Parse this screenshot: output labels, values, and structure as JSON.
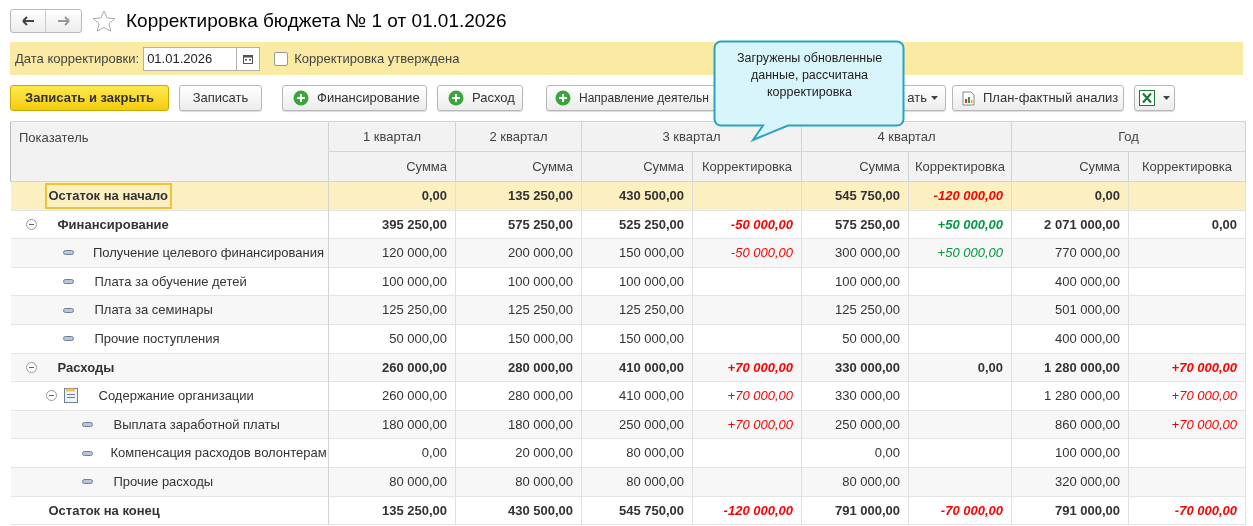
{
  "window": {
    "title": "Корректировка бюджета № 1 от 01.01.2026",
    "favorite": false
  },
  "filter": {
    "date_label": "Дата корректировки:",
    "date_value": "01.01.2026",
    "approved_label": "Корректировка утверждена",
    "approved": false
  },
  "toolbar": [
    {
      "kind": "primary",
      "label": "Записать и закрыть"
    },
    {
      "kind": "plain",
      "label": "Записать"
    },
    {
      "kind": "add",
      "label": "Финансирование"
    },
    {
      "kind": "add",
      "label": "Расход"
    },
    {
      "kind": "add_cut",
      "label": "Направление деятельн"
    },
    {
      "kind": "menu_cut",
      "label": "ать"
    },
    {
      "kind": "report",
      "label": "План-фактный анализ"
    },
    {
      "kind": "excel"
    }
  ],
  "tooltip": "Загружены обновленные данные, рассчитана корректировка",
  "table": {
    "first_column": "Показатель",
    "columns": [
      {
        "label": "1 квартал",
        "sub": [
          "Сумма"
        ]
      },
      {
        "label": "2 квартал",
        "sub": [
          "Сумма"
        ]
      },
      {
        "label": "3 квартал",
        "colspan": 2,
        "sub": [
          "Сумма",
          "Корректировка"
        ]
      },
      {
        "label": "4 квартал",
        "colspan": 2,
        "sub": [
          "Сумма",
          "Корректировка"
        ]
      },
      {
        "label": "Год",
        "colspan": 2,
        "sub": [
          "Сумма",
          "Корректировка"
        ]
      }
    ],
    "rows": [
      {
        "kind": "balance",
        "label": "Остаток на начало",
        "selected": true,
        "cells": [
          {
            "text": "0,00"
          },
          {
            "text": "135 250,00"
          },
          {
            "text": "430 500,00"
          },
          null,
          {
            "text": "545 750,00"
          },
          {
            "text": "-120 000,00",
            "color": "#ff0000"
          },
          {
            "text": "0,00"
          },
          null
        ]
      },
      {
        "kind": "group",
        "label": "Финансирование",
        "selected": false,
        "expanded": true,
        "cells": [
          {
            "text": "395 250,00"
          },
          {
            "text": "575 250,00"
          },
          {
            "text": "525 250,00"
          },
          {
            "text": "-50 000,00",
            "color": "#ff0000"
          },
          {
            "text": "575 250,00"
          },
          {
            "text": "+50 000,00",
            "color": "#009944"
          },
          {
            "text": "2 071 000,00"
          },
          {
            "text": "0,00"
          }
        ],
        "children": [
          {
            "kind": "item",
            "label": "Получение целевого финансирования",
            "selected": false,
            "cells": [
              {
                "text": "120 000,00"
              },
              {
                "text": "200 000,00"
              },
              {
                "text": "150 000,00"
              },
              {
                "text": "-50 000,00",
                "color": "#ff0000"
              },
              {
                "text": "300 000,00"
              },
              {
                "text": "+50 000,00",
                "color": "#009944"
              },
              {
                "text": "770 000,00"
              },
              null
            ]
          },
          {
            "kind": "item",
            "label": "Плата за обучение детей",
            "selected": false,
            "cells": [
              {
                "text": "100 000,00"
              },
              {
                "text": "100 000,00"
              },
              {
                "text": "100 000,00"
              },
              null,
              {
                "text": "100 000,00"
              },
              null,
              {
                "text": "400 000,00"
              },
              null
            ]
          },
          {
            "kind": "item",
            "label": "Плата за семинары",
            "selected": false,
            "cells": [
              {
                "text": "125 250,00"
              },
              {
                "text": "125 250,00"
              },
              {
                "text": "125 250,00"
              },
              null,
              {
                "text": "125 250,00"
              },
              null,
              {
                "text": "501 000,00"
              },
              null
            ]
          },
          {
            "kind": "item",
            "label": "Прочие поступления",
            "selected": false,
            "cells": [
              {
                "text": "50 000,00"
              },
              {
                "text": "150 000,00"
              },
              {
                "text": "150 000,00"
              },
              null,
              {
                "text": "50 000,00"
              },
              null,
              {
                "text": "400 000,00"
              },
              null
            ]
          }
        ]
      },
      {
        "kind": "group",
        "label": "Расходы",
        "selected": false,
        "expanded": true,
        "cells": [
          {
            "text": "260 000,00"
          },
          {
            "text": "280 000,00"
          },
          {
            "text": "410 000,00"
          },
          {
            "text": "+70 000,00",
            "color": "#ff0000"
          },
          {
            "text": "330 000,00"
          },
          {
            "text": "0,00"
          },
          {
            "text": "1 280 000,00"
          },
          {
            "text": "+70 000,00",
            "color": "#ff0000"
          }
        ],
        "children": [
          {
            "kind": "folder",
            "label": "Содержание организации",
            "selected": false,
            "expanded": true,
            "cells": [
              {
                "text": "260 000,00"
              },
              {
                "text": "280 000,00"
              },
              {
                "text": "410 000,00"
              },
              {
                "text": "+70 000,00",
                "color": "#ff0000"
              },
              {
                "text": "330 000,00"
              },
              null,
              {
                "text": "1 280 000,00"
              },
              {
                "text": "+70 000,00",
                "color": "#ff0000"
              }
            ],
            "children": [
              {
                "kind": "item",
                "label": "Выплата заработной платы",
                "selected": false,
                "cells": [
                  {
                    "text": "180 000,00"
                  },
                  {
                    "text": "180 000,00"
                  },
                  {
                    "text": "250 000,00"
                  },
                  {
                    "text": "+70 000,00",
                    "color": "#ff0000"
                  },
                  {
                    "text": "250 000,00"
                  },
                  null,
                  {
                    "text": "860 000,00"
                  },
                  {
                    "text": "+70 000,00",
                    "color": "#ff0000"
                  }
                ]
              },
              {
                "kind": "item",
                "label": "Компенсация расходов волонтерам",
                "selected": false,
                "cells": [
                  {
                    "text": "0,00"
                  },
                  {
                    "text": "20 000,00"
                  },
                  {
                    "text": "80 000,00"
                  },
                  null,
                  {
                    "text": "0,00"
                  },
                  null,
                  {
                    "text": "100 000,00"
                  },
                  null
                ]
              },
              {
                "kind": "item",
                "label": "Прочие расходы",
                "selected": false,
                "cells": [
                  {
                    "text": "80 000,00"
                  },
                  {
                    "text": "80 000,00"
                  },
                  {
                    "text": "80 000,00"
                  },
                  null,
                  {
                    "text": "80 000,00"
                  },
                  null,
                  {
                    "text": "320 000,00"
                  },
                  null
                ]
              }
            ]
          }
        ]
      },
      {
        "kind": "balance",
        "label": "Остаток на конец",
        "selected": false,
        "cells": [
          {
            "text": "135 250,00"
          },
          {
            "text": "430 500,00"
          },
          {
            "text": "545 750,00"
          },
          {
            "text": "-120 000,00",
            "color": "#ff0000"
          },
          {
            "text": "791 000,00"
          },
          {
            "text": "-70 000,00",
            "color": "#ff0000"
          },
          {
            "text": "791 000,00"
          },
          {
            "text": "-70 000,00",
            "color": "#ff0000"
          }
        ]
      }
    ]
  }
}
